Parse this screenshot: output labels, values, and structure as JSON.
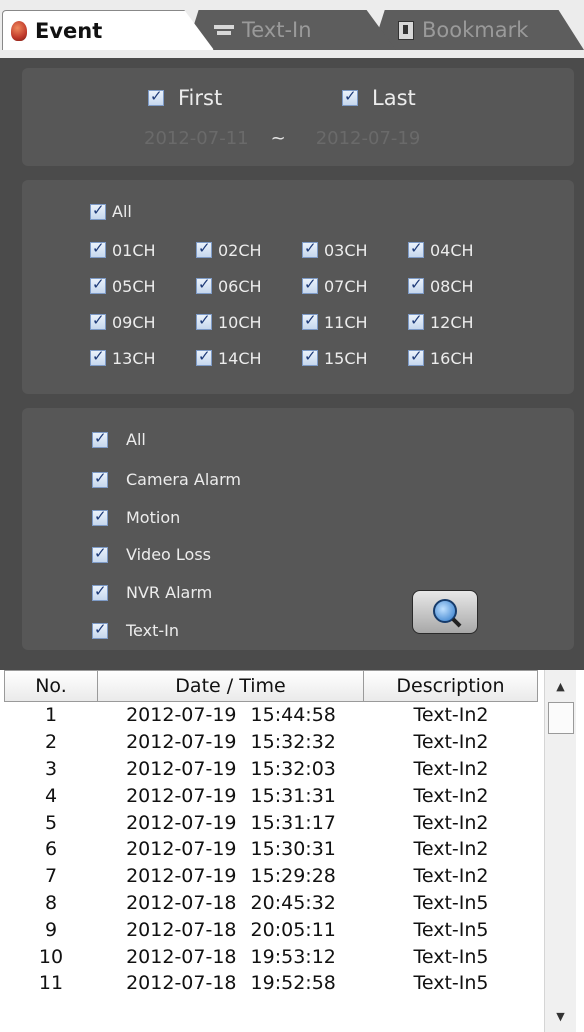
{
  "tabs": [
    {
      "label": "Event",
      "icon": "event-icon"
    },
    {
      "label": "Text-In",
      "icon": "text-in-icon"
    },
    {
      "label": "Bookmark",
      "icon": "bookmark-icon"
    }
  ],
  "date_filter": {
    "first_label": "First",
    "last_label": "Last",
    "start_date": "2012-07-11",
    "separator": "~",
    "end_date": "2012-07-19"
  },
  "channels": {
    "all_label": "All",
    "items": [
      "01CH",
      "02CH",
      "03CH",
      "04CH",
      "05CH",
      "06CH",
      "07CH",
      "08CH",
      "09CH",
      "10CH",
      "11CH",
      "12CH",
      "13CH",
      "14CH",
      "15CH",
      "16CH"
    ]
  },
  "event_types": {
    "items": [
      "All",
      "Camera Alarm",
      "Motion",
      "Video Loss",
      "NVR Alarm",
      "Text-In"
    ]
  },
  "search_button": {
    "icon": "search-icon"
  },
  "table": {
    "headers": {
      "no": "No.",
      "datetime": "Date / Time",
      "description": "Description"
    },
    "rows": [
      {
        "no": "1",
        "datetime": "2012-07-19 15:44:58",
        "description": "Text-In2"
      },
      {
        "no": "2",
        "datetime": "2012-07-19 15:32:32",
        "description": "Text-In2"
      },
      {
        "no": "3",
        "datetime": "2012-07-19 15:32:03",
        "description": "Text-In2"
      },
      {
        "no": "4",
        "datetime": "2012-07-19 15:31:31",
        "description": "Text-In2"
      },
      {
        "no": "5",
        "datetime": "2012-07-19 15:31:17",
        "description": "Text-In2"
      },
      {
        "no": "6",
        "datetime": "2012-07-19 15:30:31",
        "description": "Text-In2"
      },
      {
        "no": "7",
        "datetime": "2012-07-19 15:29:28",
        "description": "Text-In2"
      },
      {
        "no": "8",
        "datetime": "2012-07-18 20:45:32",
        "description": "Text-In5"
      },
      {
        "no": "9",
        "datetime": "2012-07-18 20:05:11",
        "description": "Text-In5"
      },
      {
        "no": "10",
        "datetime": "2012-07-18 19:53:12",
        "description": "Text-In5"
      },
      {
        "no": "11",
        "datetime": "2012-07-18 19:52:58",
        "description": "Text-In5"
      }
    ]
  },
  "colors": {
    "panel_bg": "#575757",
    "window_bg": "#4b4b4b",
    "checkbox_check": "#1f3c79"
  }
}
